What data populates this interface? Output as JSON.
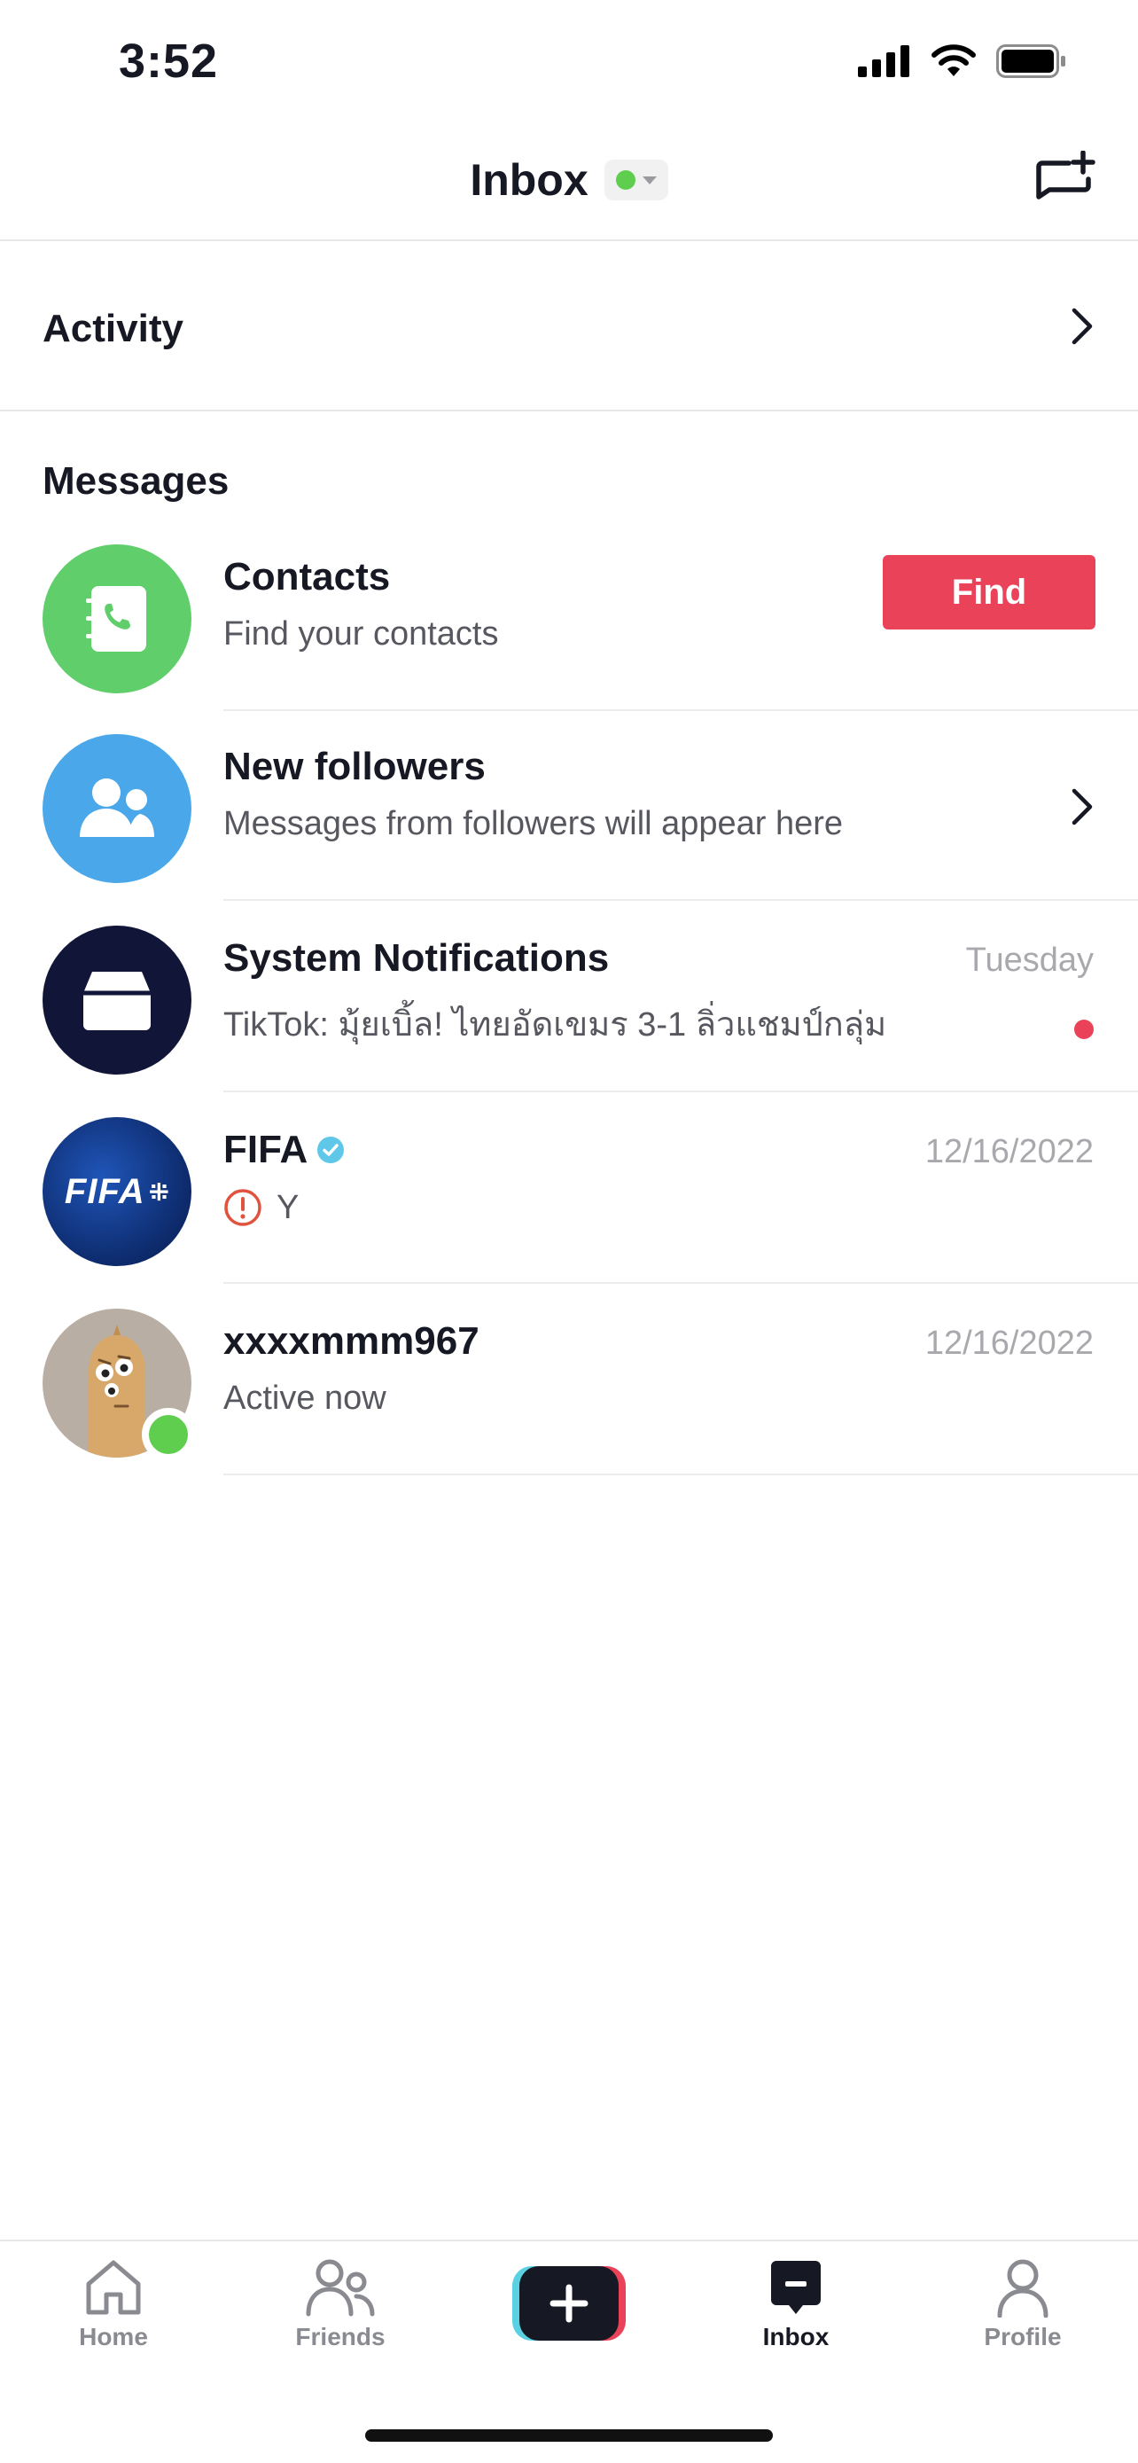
{
  "status_bar": {
    "time": "3:52"
  },
  "header": {
    "title": "Inbox"
  },
  "activity": {
    "label": "Activity"
  },
  "messages_section": {
    "title": "Messages"
  },
  "rows": [
    {
      "title": "Contacts",
      "subtitle": "Find your contacts",
      "action": "Find"
    },
    {
      "title": "New followers",
      "subtitle": "Messages from followers will appear here"
    },
    {
      "title": "System Notifications",
      "subtitle": "TikTok: มุ้ยเบิ้ล! ไทยอัดเขมร 3-1 ลิ่วแชมป์กลุ่ม",
      "date": "Tuesday"
    },
    {
      "title": "FIFA",
      "subtitle": "Y",
      "date": "12/16/2022",
      "avatar_text": "FIFA"
    },
    {
      "title": "xxxxmmm967",
      "subtitle": "Active now",
      "date": "12/16/2022"
    }
  ],
  "tabs": [
    {
      "label": "Home",
      "icon": "home-icon"
    },
    {
      "label": "Friends",
      "icon": "friends-icon"
    },
    {
      "label": "",
      "icon": "create-icon"
    },
    {
      "label": "Inbox",
      "icon": "inbox-icon"
    },
    {
      "label": "Profile",
      "icon": "profile-icon"
    }
  ],
  "colors": {
    "accent_red": "#ea4359",
    "online_green": "#5fce4f",
    "contacts_green": "#5fce6b",
    "followers_blue": "#4aa8ea",
    "system_navy": "#111538",
    "verified_cyan": "#5fc8e8"
  }
}
